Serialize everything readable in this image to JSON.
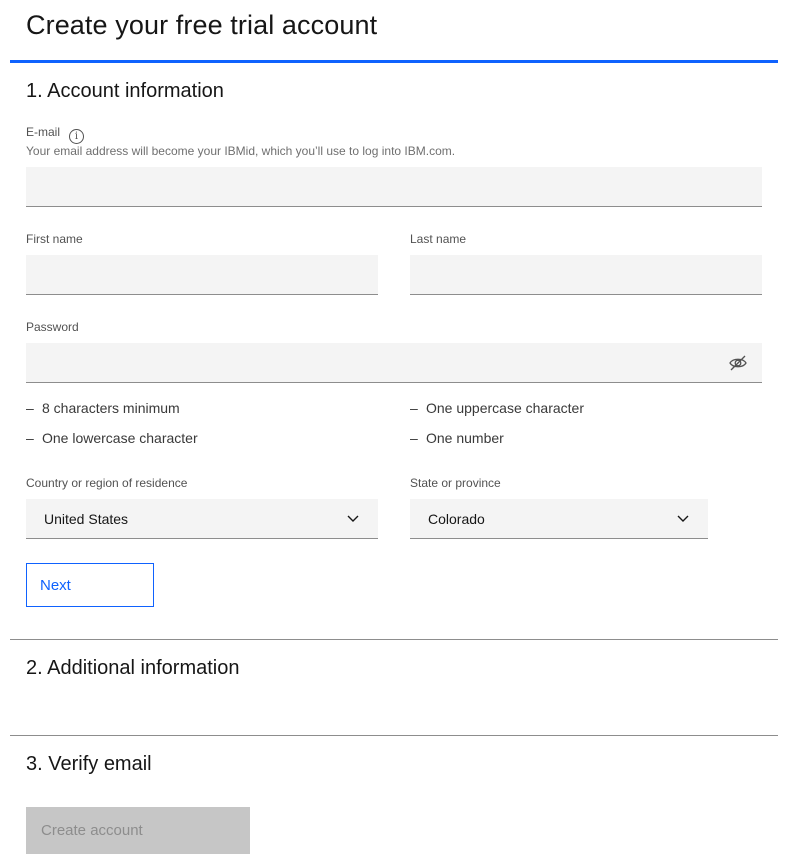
{
  "page": {
    "title": "Create your free trial account"
  },
  "sections": {
    "account": "1. Account information",
    "additional": "2. Additional information",
    "verify": "3. Verify email"
  },
  "email": {
    "label": "E-mail",
    "helper": "Your email address will become your IBMid, which you’ll use to log into IBM.com.",
    "value": "",
    "info_icon": "info-icon"
  },
  "first_name": {
    "label": "First name",
    "value": ""
  },
  "last_name": {
    "label": "Last name",
    "value": ""
  },
  "password": {
    "label": "Password",
    "value": "",
    "toggle_icon": "eye-hidden-icon"
  },
  "password_requirements": [
    {
      "dash": "–",
      "text": "8 characters minimum"
    },
    {
      "dash": "–",
      "text": "One uppercase character"
    },
    {
      "dash": "–",
      "text": "One lowercase character"
    },
    {
      "dash": "–",
      "text": "One number"
    }
  ],
  "country": {
    "label": "Country or region of residence",
    "selected": "United States",
    "icon": "chevron-down-icon"
  },
  "state": {
    "label": "State or province",
    "selected": "Colorado",
    "icon": "chevron-down-icon"
  },
  "buttons": {
    "next": "Next",
    "create_account": "Create account"
  },
  "colors": {
    "accent": "#0f62fe",
    "field_bg": "#f4f4f4",
    "disabled_bg": "#c6c6c6",
    "disabled_text": "#8d8d8d"
  }
}
